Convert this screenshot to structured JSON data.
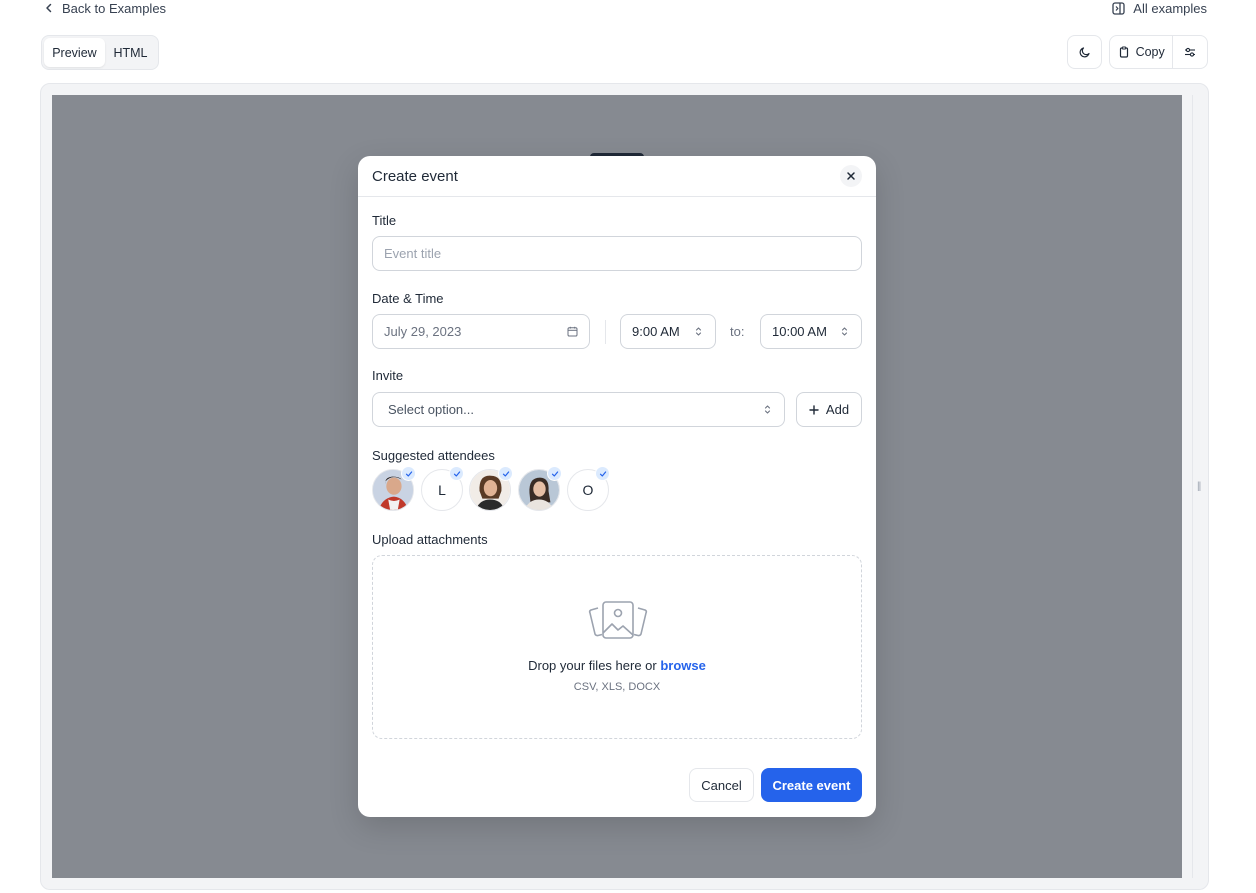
{
  "topbar": {
    "back_label": "Back to Examples",
    "all_examples_label": "All examples",
    "tabs": [
      {
        "label": "Preview",
        "active": true
      },
      {
        "label": "HTML",
        "active": false
      }
    ],
    "copy_label": "Copy",
    "icons": {
      "back": "chevron-left-icon",
      "all_examples": "sidebar-panel-icon",
      "theme": "moon-icon",
      "copy": "clipboard-icon",
      "settings": "sliders-icon"
    }
  },
  "modal": {
    "title": "Create event",
    "title_field": {
      "label": "Title",
      "placeholder": "Event title"
    },
    "datetime": {
      "label": "Date & Time",
      "date_value": "July 29, 2023",
      "start_time": "9:00 AM",
      "to_label": "to:",
      "end_time": "10:00 AM"
    },
    "invite": {
      "label": "Invite",
      "select_placeholder": "Select option...",
      "add_label": "Add"
    },
    "attendees": {
      "label": "Suggested attendees",
      "items": [
        {
          "type": "photo",
          "initial": "",
          "checked": true
        },
        {
          "type": "initial",
          "initial": "L",
          "checked": true
        },
        {
          "type": "photo",
          "initial": "",
          "checked": true
        },
        {
          "type": "photo",
          "initial": "",
          "checked": true
        },
        {
          "type": "initial",
          "initial": "O",
          "checked": true
        }
      ]
    },
    "upload": {
      "label": "Upload attachments",
      "drop_text": "Drop your files here or",
      "browse_label": "browse",
      "formats": "CSV, XLS, DOCX"
    },
    "cancel_label": "Cancel",
    "create_label": "Create event"
  },
  "colors": {
    "primary": "#2563eb",
    "overlay": "#868a91",
    "border": "#e5e7eb"
  }
}
